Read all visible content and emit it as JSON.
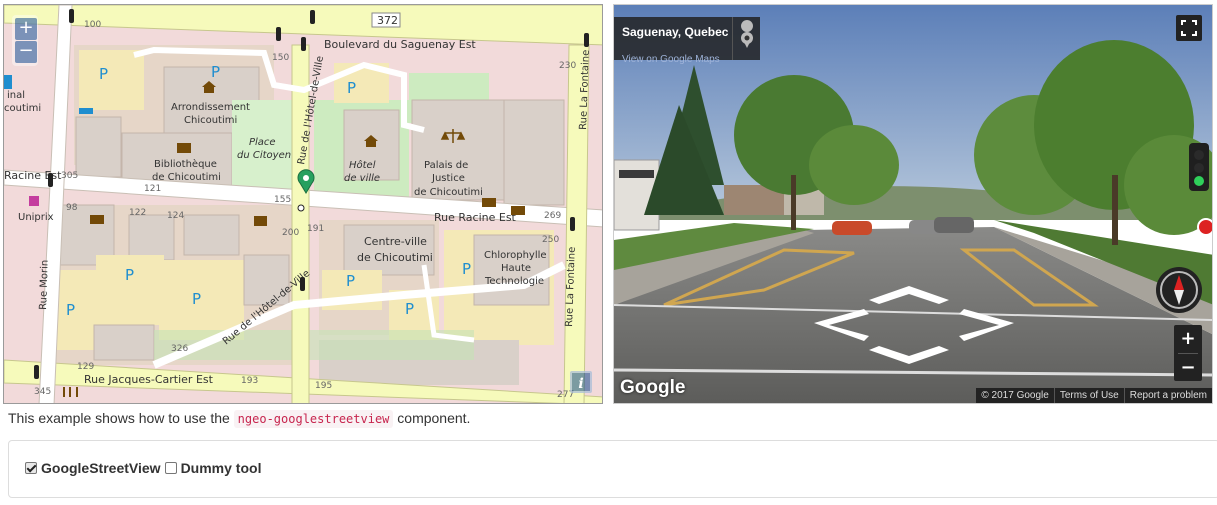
{
  "map": {
    "zoom_in": "+",
    "zoom_out": "−",
    "attribution_button": "i",
    "streets": {
      "boulevard_saguenay": "Boulevard du Saguenay Est",
      "rue_racine_e": "Rue Racine Est",
      "rue_racine_w": "Racine Est",
      "rue_hotel_de_ville_n": "Rue de l'Hôtel-de-Ville",
      "rue_hotel_de_ville_s": "Rue de l'Hôtel-de-Ville",
      "rue_la_fontaine_n": "Rue La Fontaine",
      "rue_la_fontaine_s": "Rue La Fontaine",
      "rue_morin": "Rue Morin",
      "rue_jacques_cartier": "Rue Jacques-Cartier Est"
    },
    "road_numbers": {
      "r372": "372"
    },
    "places": {
      "arrondissement_1": "Arrondissement",
      "arrondissement_2": "Chicoutimi",
      "bibliotheque_1": "Bibliothèque",
      "bibliotheque_2": "de Chicoutimi",
      "place_citoyen_1": "Place",
      "place_citoyen_2": "du Citoyen",
      "hotel_ville_1": "Hôtel",
      "hotel_ville_2": "de ville",
      "palais_1": "Palais de",
      "palais_2": "Justice",
      "palais_3": "de Chicoutimi",
      "centre_ville_1": "Centre-ville",
      "centre_ville_2": "de Chicoutimi",
      "chlorophylle_1": "Chlorophylle",
      "chlorophylle_2": "Haute",
      "chlorophylle_3": "Technologie",
      "uniprix": "Uniprix",
      "terminal_1": "inal",
      "terminal_2": "coutimi"
    },
    "house_numbers": [
      "100",
      "150",
      "230",
      "305",
      "121",
      "155",
      "98",
      "122",
      "124",
      "200",
      "191",
      "269",
      "250",
      "326",
      "129",
      "193",
      "195",
      "345",
      "277"
    ],
    "parking": "P"
  },
  "streetview": {
    "location_title": "Saguenay, Quebec",
    "view_link": "View on Google Maps",
    "logo": "Google",
    "zoom_in": "+",
    "zoom_out": "−",
    "footer": {
      "copyright": "© 2017 Google",
      "terms": "Terms of Use",
      "report": "Report a problem"
    }
  },
  "description": {
    "prefix": "This example shows how to use the",
    "code": "ngeo-googlestreetview",
    "suffix": "component."
  },
  "tools": [
    {
      "label": "GoogleStreetView",
      "checked": true
    },
    {
      "label": "Dummy tool",
      "checked": false
    }
  ]
}
